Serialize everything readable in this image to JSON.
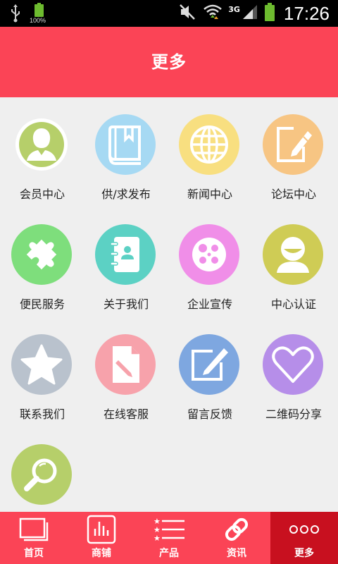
{
  "status_bar": {
    "battery_small_label": "100%",
    "network_type": "3G",
    "time": "17:26"
  },
  "header": {
    "title": "更多"
  },
  "grid": {
    "items": [
      {
        "label": "会员中心",
        "icon": "member-icon",
        "color": "#b6cf6a"
      },
      {
        "label": "供/求发布",
        "icon": "book-icon",
        "color": "#a6d9f3"
      },
      {
        "label": "新闻中心",
        "icon": "globe-icon",
        "color": "#f8df80"
      },
      {
        "label": "论坛中心",
        "icon": "edit-icon",
        "color": "#f7c583"
      },
      {
        "label": "便民服务",
        "icon": "puzzle-icon",
        "color": "#7ede7c"
      },
      {
        "label": "关于我们",
        "icon": "contact-book-icon",
        "color": "#5cd1c4"
      },
      {
        "label": "企业宣传",
        "icon": "film-reel-icon",
        "color": "#f08ee8"
      },
      {
        "label": "中心认证",
        "icon": "user-icon",
        "color": "#cfcc55"
      },
      {
        "label": "联系我们",
        "icon": "star-icon",
        "color": "#b9c2cd"
      },
      {
        "label": "在线客服",
        "icon": "document-pencil-icon",
        "color": "#f7a2ab"
      },
      {
        "label": "留言反馈",
        "icon": "note-pencil-icon",
        "color": "#7ea7e0"
      },
      {
        "label": "二维码分享",
        "icon": "heart-icon",
        "color": "#b68ee9"
      },
      {
        "label": "",
        "icon": "magnifier-icon",
        "color": "#b6cf6a"
      }
    ]
  },
  "tabbar": {
    "active_index": 4,
    "tabs": [
      {
        "label": "首页",
        "icon": "home-windows-icon"
      },
      {
        "label": "商铺",
        "icon": "shop-chart-icon"
      },
      {
        "label": "产品",
        "icon": "star-list-icon"
      },
      {
        "label": "资讯",
        "icon": "link-icon"
      },
      {
        "label": "更多",
        "icon": "more-dots-icon"
      }
    ]
  }
}
